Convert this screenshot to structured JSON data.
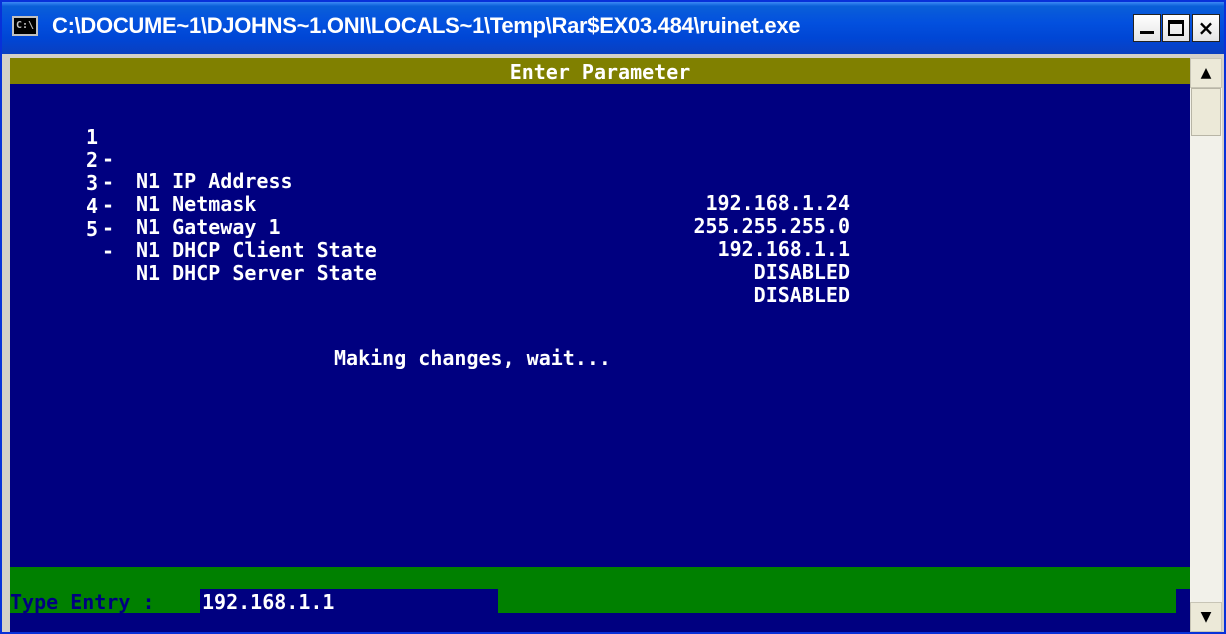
{
  "window": {
    "title": "C:\\DOCUME~1\\DJOHNS~1.ONI\\LOCALS~1\\Temp\\Rar$EX03.484\\ruinet.exe",
    "icon_label": "C:\\",
    "controls": {
      "minimize": "minimize-icon",
      "maximize": "maximize-icon",
      "close": "×"
    }
  },
  "console": {
    "header": "Enter Parameter",
    "parameters": [
      {
        "num": "1",
        "label": "N1 IP Address",
        "value": "192.168.1.24"
      },
      {
        "num": "2",
        "label": "N1 Netmask",
        "value": "255.255.255.0"
      },
      {
        "num": "3",
        "label": "N1 Gateway 1",
        "value": "192.168.1.1"
      },
      {
        "num": "4",
        "label": "N1 DHCP Client State",
        "value": "DISABLED"
      },
      {
        "num": "5",
        "label": "N1 DHCP Server State",
        "value": "DISABLED"
      }
    ],
    "status_message": "Making changes, wait...",
    "prompt_label": "Type Entry :",
    "entry_value": "192.168.1.1"
  },
  "scrollbar": {
    "up": "▲",
    "down": "▼"
  },
  "colors": {
    "console_bg": "#000080",
    "header_bg": "#808000",
    "prompt_bg": "#008000",
    "titlebar": "#0046d5"
  }
}
